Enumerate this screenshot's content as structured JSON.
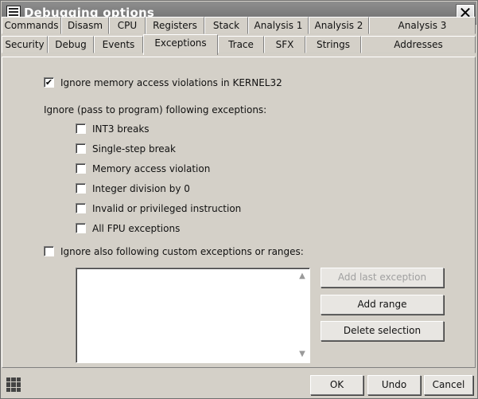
{
  "window": {
    "title": "Debugging options",
    "close_glyph": "✕"
  },
  "tabs_row1": [
    "Commands",
    "Disasm",
    "CPU",
    "Registers",
    "Stack",
    "Analysis 1",
    "Analysis 2",
    "Analysis 3"
  ],
  "tabs_row2": [
    "Security",
    "Debug",
    "Events",
    "Exceptions",
    "Trace",
    "SFX",
    "Strings",
    "Addresses"
  ],
  "active_tab": "Exceptions",
  "panel": {
    "ignore_kernel32": {
      "label": "Ignore memory access violations in KERNEL32",
      "checked": true
    },
    "pass_heading": "Ignore (pass to program) following exceptions:",
    "exceptions": [
      {
        "label": "INT3 breaks",
        "checked": false
      },
      {
        "label": "Single-step break",
        "checked": false
      },
      {
        "label": "Memory access violation",
        "checked": false
      },
      {
        "label": "Integer division by 0",
        "checked": false
      },
      {
        "label": "Invalid or privileged instruction",
        "checked": false
      },
      {
        "label": "All FPU exceptions",
        "checked": false
      }
    ],
    "custom_exceptions": {
      "label": "Ignore also following custom exceptions or ranges:",
      "checked": false
    },
    "list_items": [],
    "buttons": {
      "add_last_exception": "Add last exception",
      "add_range": "Add range",
      "delete_selection": "Delete selection"
    }
  },
  "footer": {
    "ok": "OK",
    "undo": "Undo",
    "cancel": "Cancel"
  },
  "icons": {
    "title_icon": "window-list-icon",
    "status_icon": "grid-icon"
  }
}
